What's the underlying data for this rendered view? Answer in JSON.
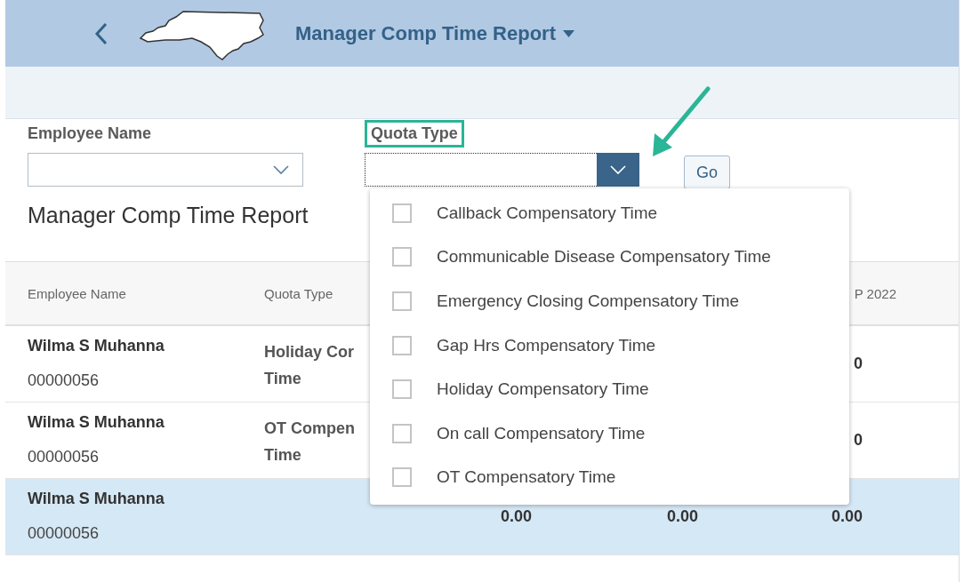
{
  "header": {
    "title": "Manager Comp Time Report"
  },
  "filters": [
    {
      "label": "Employee Name",
      "highlighted": false,
      "focused": false
    },
    {
      "label": "Quota Type",
      "highlighted": true,
      "focused": true
    }
  ],
  "go_button": "Go",
  "report_title": "Manager Comp Time Report",
  "table": {
    "columns": [
      "Employee Name",
      "Quota Type",
      "P 2022"
    ],
    "rows": [
      {
        "name": "Wilma S Muhanna",
        "id": "00000056",
        "quota_type": "Holiday Cor\nTime",
        "column_5": "0",
        "selected": false
      },
      {
        "name": "Wilma S Muhanna",
        "id": "00000056",
        "quota_type": "OT Compen\nTime",
        "column_5": "0",
        "selected": false
      },
      {
        "name": "Wilma S Muhanna",
        "id": "00000056",
        "column_3": "0.00",
        "column_4": "0.00",
        "column_5": "0.00",
        "selected": true
      }
    ]
  },
  "quota_options": [
    {
      "label": "Callback Compensatory Time",
      "checked": false
    },
    {
      "label": "Communicable Disease Compensatory Time",
      "checked": false
    },
    {
      "label": "Emergency Closing Compensatory Time",
      "checked": false
    },
    {
      "label": "Gap Hrs Compensatory Time",
      "checked": false
    },
    {
      "label": "Holiday Compensatory Time",
      "checked": false
    },
    {
      "label": "On call Compensatory Time",
      "checked": false
    },
    {
      "label": "OT Compensatory Time",
      "checked": false
    }
  ]
}
